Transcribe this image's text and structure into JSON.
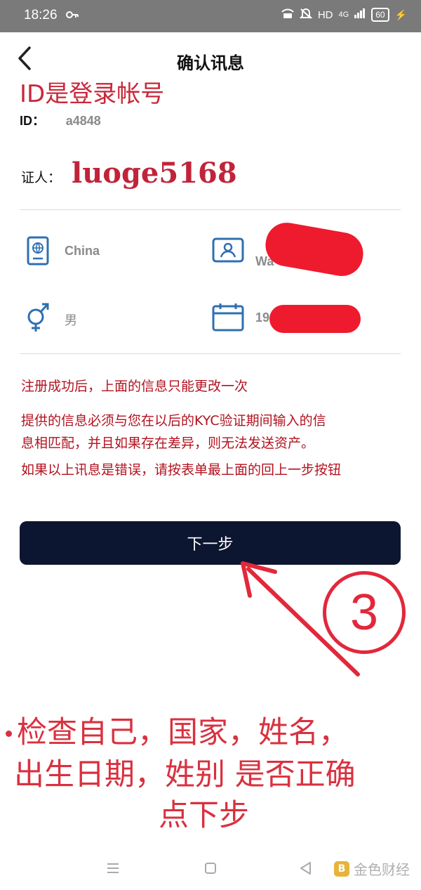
{
  "status": {
    "time": "18:26",
    "network": "HD",
    "signal": "4G",
    "battery": "60"
  },
  "page": {
    "title": "确认讯息"
  },
  "annotations": {
    "id_note": "ID是登录帐号",
    "step_number": "3",
    "line1": "检查自己，国家，姓名，",
    "line2": "出生日期，姓别 是否正确",
    "line3": "点下步"
  },
  "account": {
    "id_label": "ID：",
    "id_value": "a4848",
    "witness_label": "证人：",
    "witness_value": "luoge5168"
  },
  "profile": {
    "country": "China",
    "name_partial": "Wa",
    "gender": "男",
    "birth_partial": "19"
  },
  "notices": [
    "注册成功后，上面的信息只能更改一次",
    "提供的信息必须与您在以后的KYC验证期间输入的信",
    "息相匹配，并且如果存在差异，则无法发送资产。",
    "如果以上讯息是错误，请按表单最上面的回上一步按钮"
  ],
  "buttons": {
    "next": "下一步"
  },
  "watermark": {
    "text": "金色财经"
  },
  "icons": [
    "back-icon",
    "passport-icon",
    "id-card-icon",
    "gender-icon",
    "calendar-icon",
    "key-icon",
    "menu-icon",
    "home-icon",
    "back-nav-icon"
  ],
  "colors": {
    "annotation_red": "#d9313f",
    "notice_red": "#b2121f",
    "icon_blue": "#2f6fb0",
    "button_navy": "#0d1630"
  }
}
